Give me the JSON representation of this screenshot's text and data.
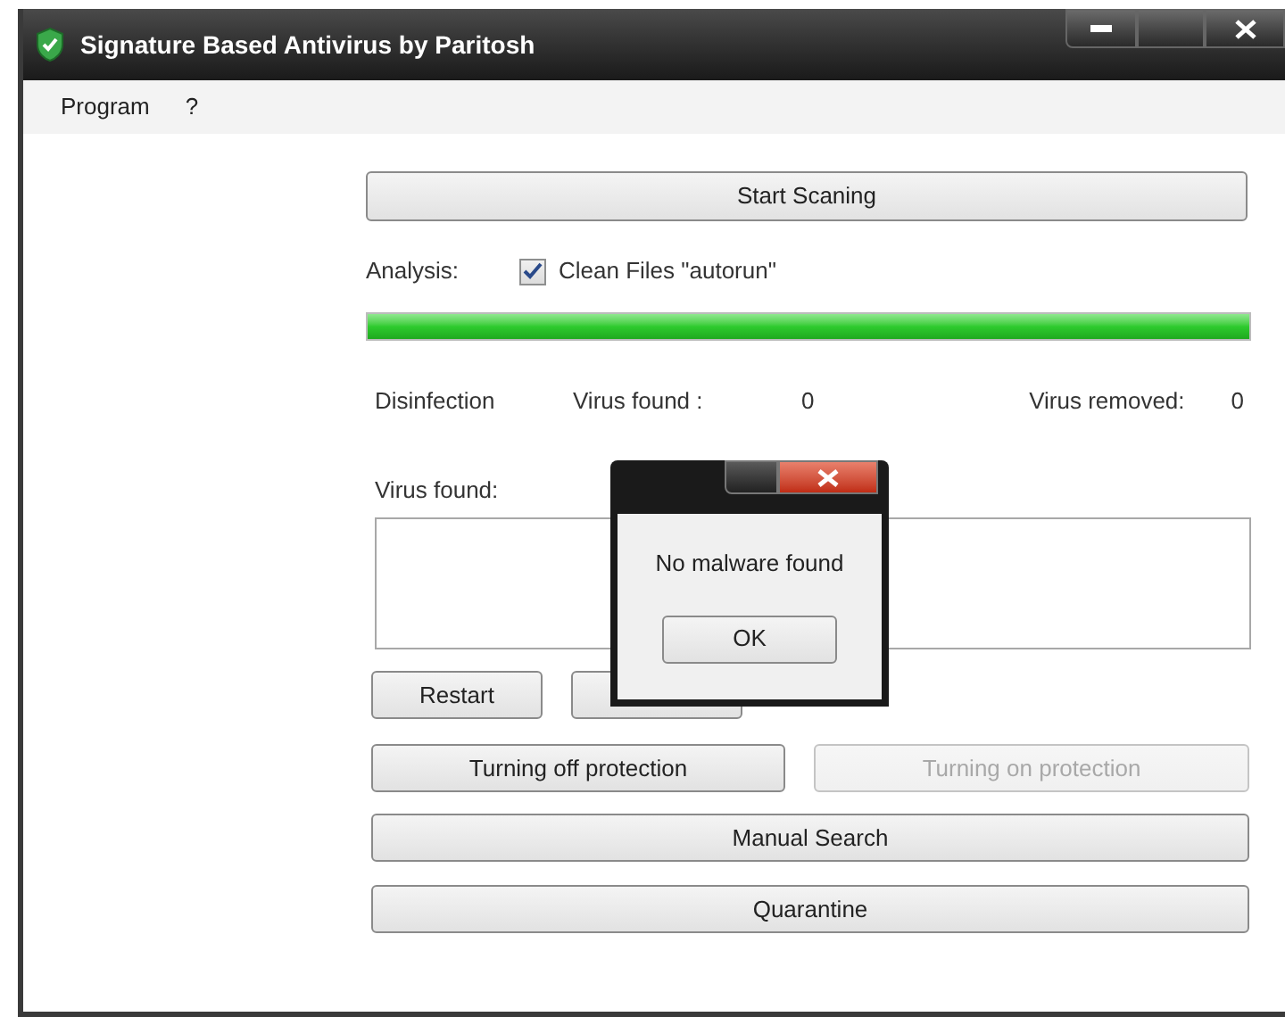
{
  "window": {
    "title": "Signature Based Antivirus by Paritosh"
  },
  "menu": [
    {
      "label": "Program"
    },
    {
      "label": "?"
    }
  ],
  "scan_button": "Start Scaning",
  "analysis": {
    "label": "Analysis:",
    "option": {
      "label": "Clean Files \"autorun\"",
      "checked": true
    }
  },
  "progress": {
    "level": 1
  },
  "stats": {
    "title": "Disinfection",
    "found_label": "Virus found :",
    "found_value": "0",
    "removed_label": "Virus removed:",
    "removed_value": "0"
  },
  "found_list": {
    "label": "Virus found:"
  },
  "restart_button": "Restart",
  "protection_buttons": [
    {
      "label": "Turning off protection",
      "disabled": false
    },
    {
      "label": "Turning on protection",
      "disabled": true
    }
  ],
  "wide_buttons": [
    {
      "label": "Manual Search"
    },
    {
      "label": "Quarantine"
    }
  ],
  "dialog": {
    "message": "No malware found",
    "button": "OK"
  }
}
